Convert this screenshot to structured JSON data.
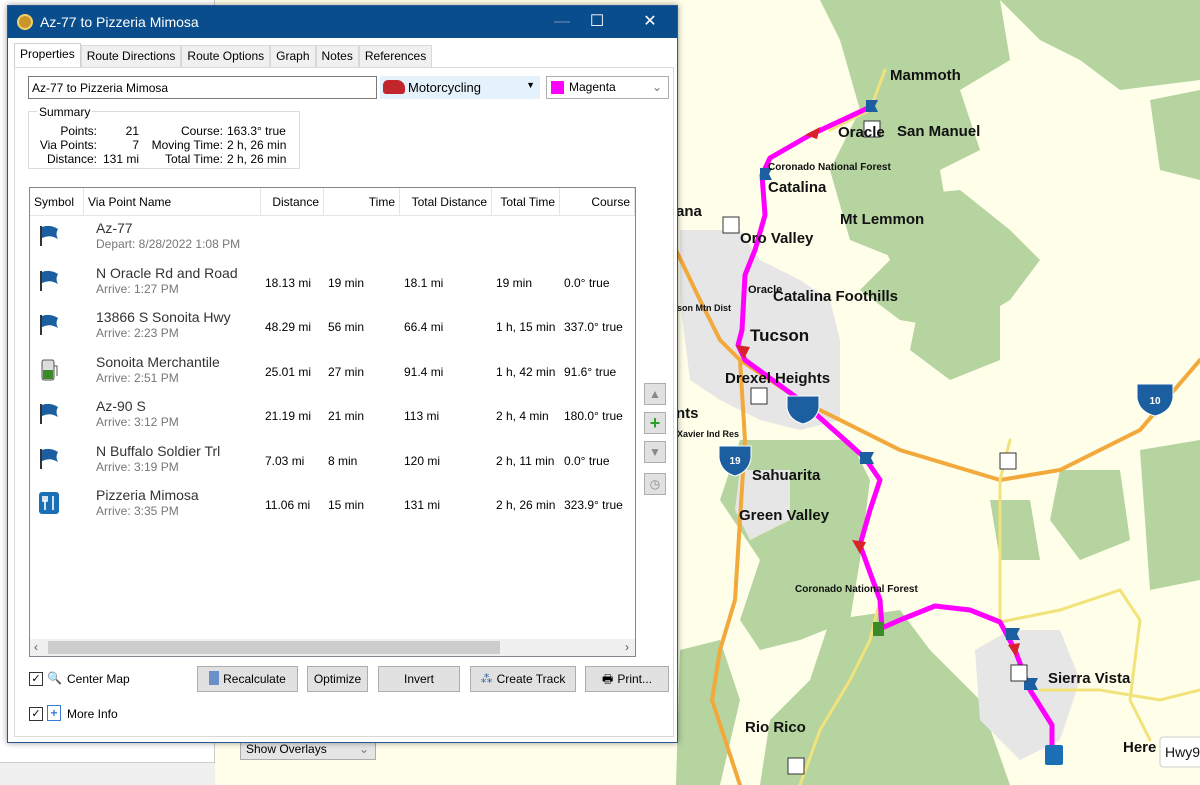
{
  "window": {
    "title": "Az-77 to Pizzeria Mimosa",
    "minimize": "—",
    "maximize": "☐",
    "close": "✕"
  },
  "tabs": [
    {
      "label": "Properties"
    },
    {
      "label": "Route Directions"
    },
    {
      "label": "Route Options"
    },
    {
      "label": "Graph"
    },
    {
      "label": "Notes"
    },
    {
      "label": "References"
    }
  ],
  "route": {
    "name": "Az-77 to Pizzeria Mimosa",
    "activity": "Motorcycling",
    "color": "Magenta",
    "color_hex": "#ff00ff"
  },
  "summary": {
    "legend": "Summary",
    "points_label": "Points:",
    "points": "21",
    "via_label": "Via Points:",
    "via": "7",
    "distance_label": "Distance:",
    "distance": "131 mi",
    "course_label": "Course:",
    "course": "163.3° true",
    "moving_label": "Moving Time:",
    "moving": "2 h, 26 min",
    "total_label": "Total Time:",
    "total": "2 h, 26 min"
  },
  "columns": [
    "Symbol",
    "Via Point Name",
    "Distance",
    "Time",
    "Total Distance",
    "Total Time",
    "Course"
  ],
  "rows": [
    {
      "icon": "flag",
      "name": "Az-77",
      "sub": "Depart: 8/28/2022 1:08 PM",
      "distance": "",
      "time": "",
      "total_distance": "",
      "total_time": "",
      "course": ""
    },
    {
      "icon": "flag",
      "name": "N Oracle Rd and Road",
      "sub": "Arrive: 1:27 PM",
      "distance": "18.13 mi",
      "time": "19 min",
      "total_distance": "18.1 mi",
      "total_time": "19 min",
      "course": "0.0° true"
    },
    {
      "icon": "flag",
      "name": "13866 S Sonoita Hwy",
      "sub": "Arrive: 2:23 PM",
      "distance": "48.29 mi",
      "time": "56 min",
      "total_distance": "66.4 mi",
      "total_time": "1 h, 15 min",
      "course": "337.0° true"
    },
    {
      "icon": "gas",
      "name": "Sonoita Merchantile",
      "sub": "Arrive: 2:51 PM",
      "distance": "25.01 mi",
      "time": "27 min",
      "total_distance": "91.4 mi",
      "total_time": "1 h, 42 min",
      "course": "91.6° true"
    },
    {
      "icon": "flag",
      "name": "Az-90 S",
      "sub": "Arrive: 3:12 PM",
      "distance": "21.19 mi",
      "time": "21 min",
      "total_distance": "113 mi",
      "total_time": "2 h, 4 min",
      "course": "180.0° true"
    },
    {
      "icon": "flag",
      "name": "N Buffalo Soldier Trl",
      "sub": "Arrive: 3:19 PM",
      "distance": "7.03 mi",
      "time": "8 min",
      "total_distance": "120 mi",
      "total_time": "2 h, 11 min",
      "course": "0.0° true"
    },
    {
      "icon": "restaurant",
      "name": "Pizzeria Mimosa",
      "sub": "Arrive: 3:35 PM",
      "distance": "11.06 mi",
      "time": "15 min",
      "total_distance": "131 mi",
      "total_time": "2 h, 26 min",
      "course": "323.9° true"
    }
  ],
  "buttons": {
    "recalculate": "Recalculate",
    "optimize": "Optimize",
    "invert": "Invert",
    "create_track": "Create Track",
    "print": "Print..."
  },
  "checkboxes": {
    "center_map": "Center Map",
    "center_map_checked": true,
    "more_info": "More Info",
    "more_info_checked": true
  },
  "overlays": {
    "label": "Show Overlays"
  },
  "map": {
    "route_color": "#ff00ff",
    "labels": {
      "mammoth": "Mammoth",
      "oracle": "Oracle",
      "san_manuel": "San Manuel",
      "coronado1": "Coronado National Forest",
      "catalina": "Catalina",
      "ana": "ana",
      "mt_lemmon": "Mt Lemmon",
      "oro_valley": "Oro Valley",
      "oracle2": "Oracle",
      "tucson_mtn": "son Mtn Dist",
      "catalina_foothills": "Catalina Foothills",
      "tucson": "Tucson",
      "drexel": "Drexel Heights",
      "nts": "nts",
      "xavier": "Xavier Ind Res",
      "sahuarita": "Sahuarita",
      "green_valley": "Green Valley",
      "coronado2": "Coronado National Forest",
      "sierra_vista": "Sierra Vista",
      "rio_rico": "Rio Rico",
      "hereford": "Here"
    },
    "shields": {
      "i10": "10",
      "i19": "19"
    },
    "tooltip": "Hwy9"
  }
}
